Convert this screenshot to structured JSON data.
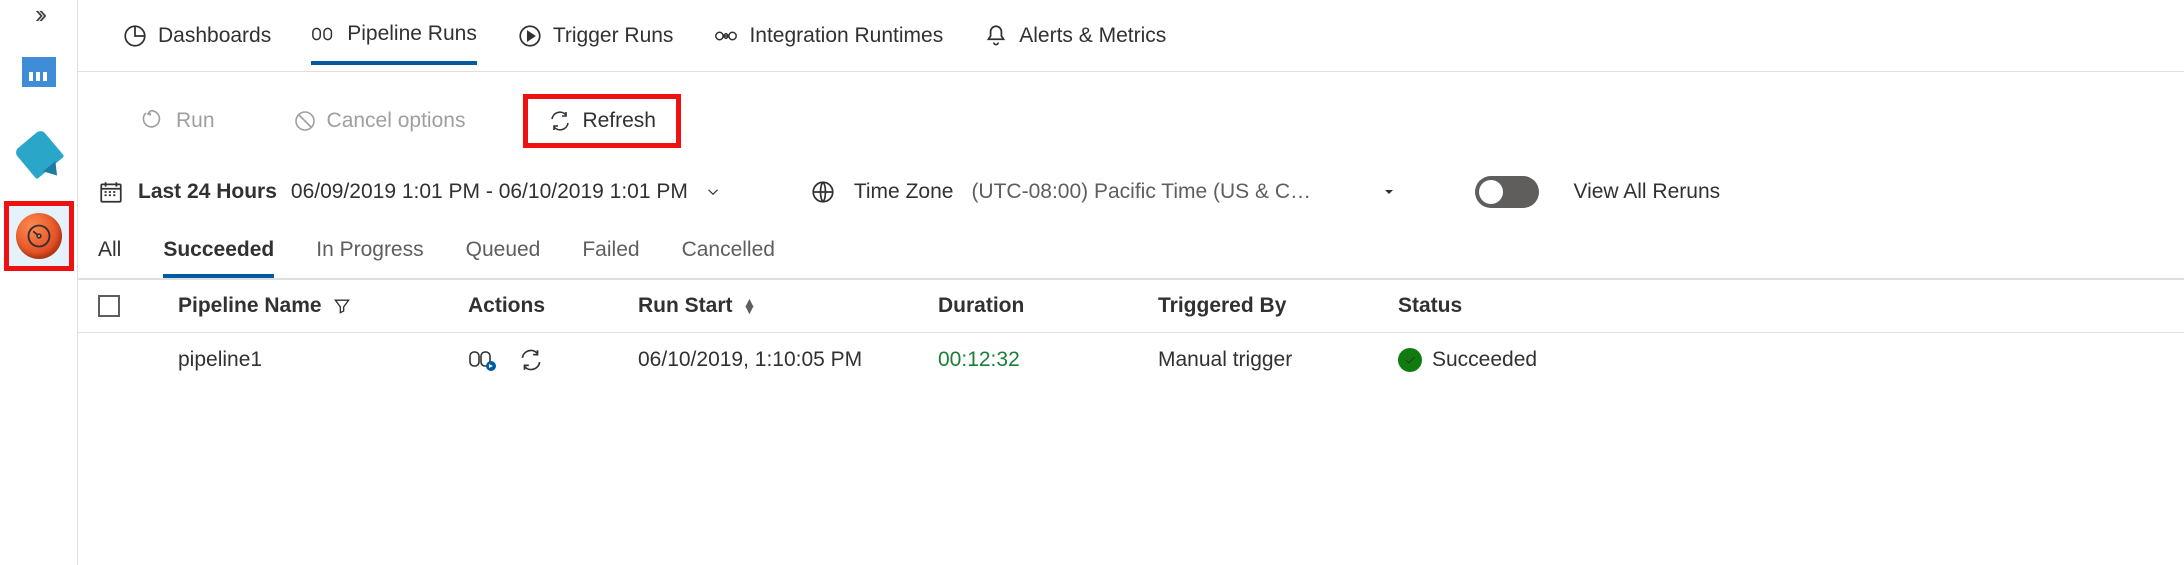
{
  "rail": {
    "expand_glyph": "››"
  },
  "tabs": {
    "dashboards": "Dashboards",
    "pipeline_runs": "Pipeline Runs",
    "trigger_runs": "Trigger Runs",
    "integration_runtimes": "Integration Runtimes",
    "alerts_metrics": "Alerts & Metrics"
  },
  "toolbar": {
    "run": "Run",
    "cancel": "Cancel options",
    "refresh": "Refresh"
  },
  "filter": {
    "range_label": "Last 24 Hours",
    "range_value": "06/09/2019 1:01 PM - 06/10/2019 1:01 PM",
    "tz_label": "Time Zone",
    "tz_value": "(UTC-08:00) Pacific Time (US & Ca…",
    "view_all": "View All Reruns"
  },
  "status_tabs": [
    "All",
    "Succeeded",
    "In Progress",
    "Queued",
    "Failed",
    "Cancelled"
  ],
  "status_tabs_selected": "Succeeded",
  "columns": {
    "pipeline_name": "Pipeline Name",
    "actions": "Actions",
    "run_start": "Run Start",
    "duration": "Duration",
    "triggered_by": "Triggered By",
    "status": "Status"
  },
  "rows": [
    {
      "name": "pipeline1",
      "run_start": "06/10/2019, 1:10:05 PM",
      "duration": "00:12:32",
      "triggered_by": "Manual trigger",
      "status": "Succeeded"
    }
  ]
}
